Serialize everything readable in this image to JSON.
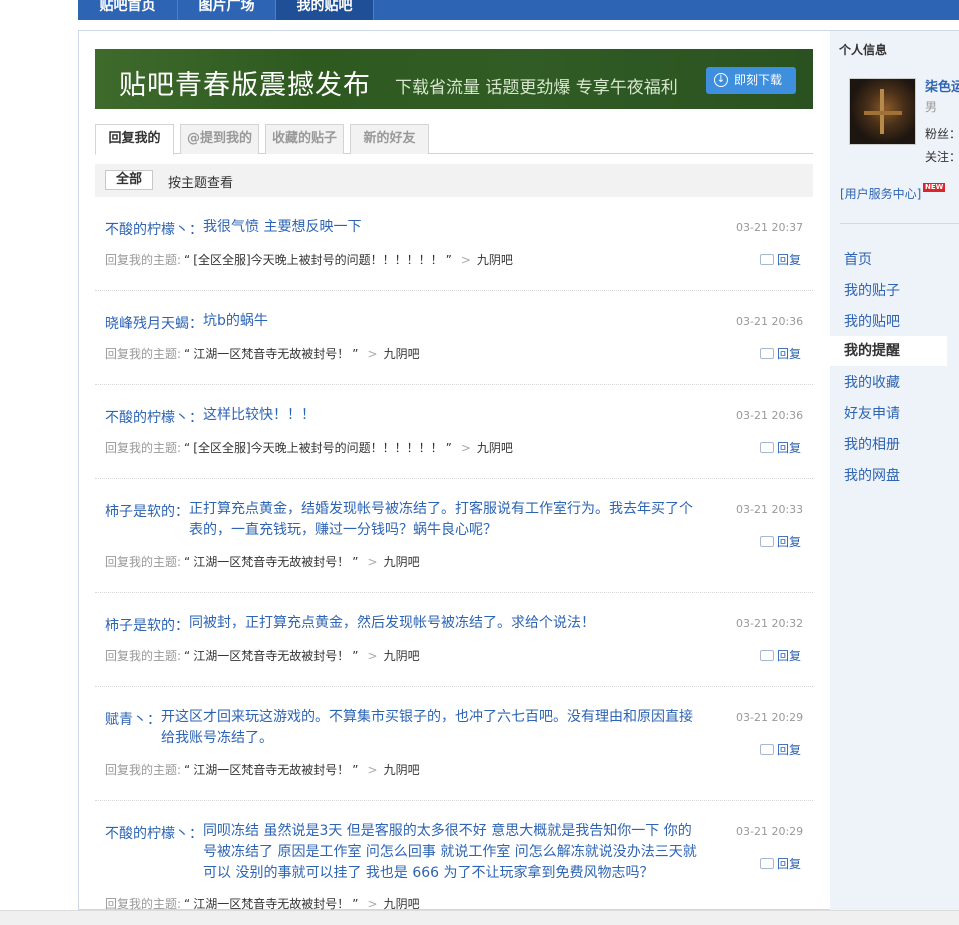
{
  "topnav": {
    "tabs": [
      {
        "label": "贴吧首页"
      },
      {
        "label": "图片广场"
      },
      {
        "label": "我的贴吧"
      }
    ]
  },
  "banner": {
    "title": "贴吧青春版震撼发布",
    "subtitle": "下载省流量 话题更劲爆 专享午夜福利",
    "download_label": "即刻下载"
  },
  "subtabs": [
    {
      "label": "回复我的"
    },
    {
      "label": "@提到我的"
    },
    {
      "label": "收藏的贴子"
    },
    {
      "label": "新的好友"
    }
  ],
  "filter": {
    "all_label": "全部",
    "by_topic_label": "按主题查看"
  },
  "labels": {
    "reply_to_topic": "回复我的主题:",
    "reply_button": "回复",
    "quote_open": "“",
    "quote_close": "”",
    "arrow": ">"
  },
  "replies": [
    {
      "author": "不酸的柠檬丶：",
      "content": "我很气愤 主要想反映一下",
      "time": "03-21 20:37",
      "thread": "[全区全服]今天晚上被封号的问题！！！！！！",
      "bar": "九阴吧"
    },
    {
      "author": "晓峰残月天蝎：",
      "content": "坑b的蜗牛",
      "time": "03-21 20:36",
      "thread": "江湖一区梵音寺无故被封号！",
      "bar": "九阴吧"
    },
    {
      "author": "不酸的柠檬丶：",
      "content": "这样比较快！！！",
      "time": "03-21 20:36",
      "thread": "[全区全服]今天晚上被封号的问题！！！！！！",
      "bar": "九阴吧"
    },
    {
      "author": "柿子是软的：",
      "content": "正打算充点黄金，结婚发现帐号被冻结了。打客服说有工作室行为。我去年买了个表的，一直充钱玩，赚过一分钱吗？蜗牛良心呢？",
      "time": "03-21 20:33",
      "thread": "江湖一区梵音寺无故被封号！",
      "bar": "九阴吧"
    },
    {
      "author": "柿子是软的：",
      "content": "同被封，正打算充点黄金，然后发现帐号被冻结了。求给个说法！",
      "time": "03-21 20:32",
      "thread": "江湖一区梵音寺无故被封号！",
      "bar": "九阴吧"
    },
    {
      "author": "赋青丶：",
      "content": "开这区才回来玩这游戏的。不算集市买银子的，也冲了六七百吧。没有理由和原因直接给我账号冻结了。",
      "time": "03-21 20:29",
      "thread": "江湖一区梵音寺无故被封号！",
      "bar": "九阴吧"
    },
    {
      "author": "不酸的柠檬丶：",
      "content": "同呗冻结 虽然说是3天 但是客服的太多很不好 意思大概就是我告知你一下 你的号被冻结了 原因是工作室 问怎么回事 就说工作室 问怎么解冻就说没办法三天就可以 没别的事就可以挂了 我也是 666 为了不让玩家拿到免费风物志吗？",
      "time": "03-21 20:29",
      "thread": "江湖一区梵音寺无故被封号！",
      "bar": "九阴吧"
    }
  ],
  "sidebar": {
    "heading": "个人信息",
    "username": "柒色运",
    "gender": "男",
    "fans_label": "粉丝：",
    "follow_label": "关注：",
    "service_label": "[用户服务中心]",
    "new_badge": "NEW",
    "nav": [
      {
        "label": "首页"
      },
      {
        "label": "我的贴子"
      },
      {
        "label": "我的贴吧"
      },
      {
        "label": "我的提醒"
      },
      {
        "label": "我的收藏"
      },
      {
        "label": "好友申请"
      },
      {
        "label": "我的相册"
      },
      {
        "label": "我的网盘"
      }
    ]
  }
}
